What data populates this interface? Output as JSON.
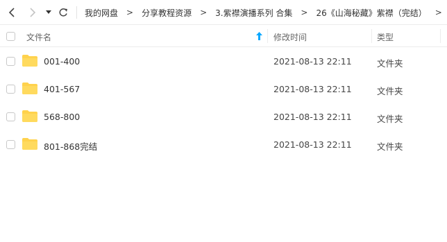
{
  "toolbar": {
    "back_icon": "chevron-left-icon",
    "forward_icon": "chevron-right-icon",
    "history_icon": "caret-down-icon",
    "refresh_icon": "refresh-icon"
  },
  "breadcrumb": [
    "我的网盘",
    "分享教程资源",
    "3.紫襟演播系列 合集",
    "26《山海秘藏》紫襟（完结）"
  ],
  "breadcrumb_separator": ">",
  "columns": {
    "name": "文件名",
    "modified": "修改时间",
    "type": "类型"
  },
  "rows": [
    {
      "name": "001-400",
      "modified": "2021-08-13 22:11",
      "type": "文件夹"
    },
    {
      "name": "401-567",
      "modified": "2021-08-13 22:11",
      "type": "文件夹"
    },
    {
      "name": "568-800",
      "modified": "2021-08-13 22:11",
      "type": "文件夹"
    },
    {
      "name": "801-868完结",
      "modified": "2021-08-13 22:11",
      "type": "文件夹"
    }
  ],
  "colors": {
    "folder": "#FFD24D",
    "accent": "#06A7FF"
  }
}
